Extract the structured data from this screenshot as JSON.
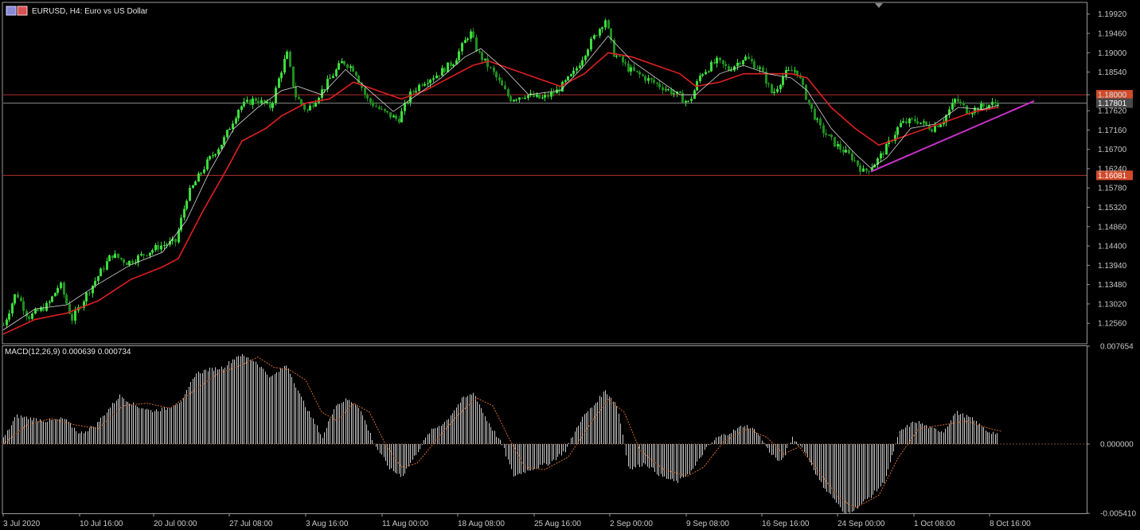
{
  "window": {
    "title": "EURUSD, H4:  Euro vs US Dollar",
    "symbol_icon": "flag-pair-icon"
  },
  "colors": {
    "background": "#000000",
    "bull_candle": "#3ddc3d",
    "bear_candle": "#1f8f1f",
    "ma_slow": "#e02020",
    "ma_fast": "#d8d8d8",
    "level_line": "#b0302a",
    "current_price_line": "#8a8a8a",
    "trendline": "#c832c8",
    "macd_hist": "#c8c8c8",
    "macd_signal": "#d2692a",
    "frame": "#9a9a9a"
  },
  "chart_data": [
    {
      "type": "candlestick",
      "instrument": "EURUSD",
      "timeframe": "H4",
      "title": "EURUSD, H4:  Euro vs US Dollar",
      "ylim": [
        1.1209,
        1.2018
      ],
      "y_ticks": [
        "1.19920",
        "1.19460",
        "1.19000",
        "1.18540",
        "1.18000",
        "1.17620",
        "1.17160",
        "1.16700",
        "1.16240",
        "1.15780",
        "1.15320",
        "1.14860",
        "1.14400",
        "1.13940",
        "1.13480",
        "1.13020",
        "1.12560"
      ],
      "x_ticks": [
        "3 Jul 2020",
        "10 Jul 16:00",
        "20 Jul 00:00",
        "27 Jul 08:00",
        "3 Aug 16:00",
        "11 Aug 00:00",
        "18 Aug 08:00",
        "25 Aug 16:00",
        "2 Sep 00:00",
        "9 Sep 08:00",
        "16 Sep 16:00",
        "24 Sep 00:00",
        "1 Oct 08:00",
        "8 Oct 16:00"
      ],
      "close_path": [
        [
          0,
          1.1232
        ],
        [
          20,
          1.133
        ],
        [
          35,
          1.127
        ],
        [
          60,
          1.13
        ],
        [
          75,
          1.135
        ],
        [
          90,
          1.1265
        ],
        [
          110,
          1.133
        ],
        [
          140,
          1.142
        ],
        [
          160,
          1.14
        ],
        [
          180,
          1.142
        ],
        [
          200,
          1.144
        ],
        [
          220,
          1.145
        ],
        [
          235,
          1.156
        ],
        [
          260,
          1.164
        ],
        [
          280,
          1.169
        ],
        [
          300,
          1.177
        ],
        [
          320,
          1.179
        ],
        [
          340,
          1.177
        ],
        [
          350,
          1.184
        ],
        [
          360,
          1.19
        ],
        [
          370,
          1.18
        ],
        [
          385,
          1.176
        ],
        [
          400,
          1.18
        ],
        [
          415,
          1.184
        ],
        [
          430,
          1.188
        ],
        [
          445,
          1.186
        ],
        [
          460,
          1.179
        ],
        [
          480,
          1.176
        ],
        [
          500,
          1.174
        ],
        [
          515,
          1.18
        ],
        [
          530,
          1.183
        ],
        [
          550,
          1.185
        ],
        [
          570,
          1.188
        ],
        [
          590,
          1.195
        ],
        [
          600,
          1.19
        ],
        [
          620,
          1.185
        ],
        [
          640,
          1.179
        ],
        [
          660,
          1.18
        ],
        [
          680,
          1.179
        ],
        [
          700,
          1.181
        ],
        [
          720,
          1.185
        ],
        [
          740,
          1.192
        ],
        [
          760,
          1.198
        ],
        [
          770,
          1.19
        ],
        [
          790,
          1.186
        ],
        [
          810,
          1.184
        ],
        [
          830,
          1.182
        ],
        [
          850,
          1.18
        ],
        [
          865,
          1.178
        ],
        [
          880,
          1.185
        ],
        [
          900,
          1.188
        ],
        [
          915,
          1.186
        ],
        [
          935,
          1.189
        ],
        [
          955,
          1.186
        ],
        [
          970,
          1.18
        ],
        [
          985,
          1.185
        ],
        [
          1000,
          1.186
        ],
        [
          1015,
          1.178
        ],
        [
          1030,
          1.172
        ],
        [
          1050,
          1.168
        ],
        [
          1070,
          1.165
        ],
        [
          1085,
          1.1615
        ],
        [
          1100,
          1.164
        ],
        [
          1115,
          1.168
        ],
        [
          1130,
          1.173
        ],
        [
          1150,
          1.174
        ],
        [
          1170,
          1.172
        ],
        [
          1185,
          1.174
        ],
        [
          1200,
          1.179
        ],
        [
          1215,
          1.176
        ],
        [
          1230,
          1.177
        ],
        [
          1250,
          1.178
        ]
      ],
      "ma_fast_path": [
        [
          0,
          1.124
        ],
        [
          40,
          1.129
        ],
        [
          80,
          1.13
        ],
        [
          120,
          1.135
        ],
        [
          160,
          1.1395
        ],
        [
          200,
          1.1425
        ],
        [
          230,
          1.15
        ],
        [
          260,
          1.162
        ],
        [
          290,
          1.172
        ],
        [
          320,
          1.177
        ],
        [
          350,
          1.181
        ],
        [
          370,
          1.182
        ],
        [
          400,
          1.18
        ],
        [
          430,
          1.186
        ],
        [
          460,
          1.181
        ],
        [
          490,
          1.176
        ],
        [
          520,
          1.18
        ],
        [
          550,
          1.184
        ],
        [
          580,
          1.189
        ],
        [
          600,
          1.191
        ],
        [
          630,
          1.186
        ],
        [
          660,
          1.18
        ],
        [
          700,
          1.181
        ],
        [
          730,
          1.187
        ],
        [
          760,
          1.194
        ],
        [
          790,
          1.188
        ],
        [
          820,
          1.184
        ],
        [
          850,
          1.18
        ],
        [
          870,
          1.18
        ],
        [
          900,
          1.185
        ],
        [
          930,
          1.187
        ],
        [
          960,
          1.185
        ],
        [
          990,
          1.184
        ],
        [
          1010,
          1.181
        ],
        [
          1040,
          1.172
        ],
        [
          1070,
          1.166
        ],
        [
          1090,
          1.1625
        ],
        [
          1110,
          1.165
        ],
        [
          1140,
          1.172
        ],
        [
          1170,
          1.173
        ],
        [
          1200,
          1.177
        ],
        [
          1230,
          1.1765
        ],
        [
          1250,
          1.1775
        ]
      ],
      "ma_slow_path": [
        [
          0,
          1.123
        ],
        [
          40,
          1.1265
        ],
        [
          80,
          1.128
        ],
        [
          120,
          1.131
        ],
        [
          160,
          1.136
        ],
        [
          200,
          1.139
        ],
        [
          220,
          1.141
        ],
        [
          250,
          1.152
        ],
        [
          280,
          1.162
        ],
        [
          300,
          1.169
        ],
        [
          330,
          1.172
        ],
        [
          350,
          1.175
        ],
        [
          380,
          1.178
        ],
        [
          410,
          1.179
        ],
        [
          440,
          1.183
        ],
        [
          470,
          1.181
        ],
        [
          500,
          1.179
        ],
        [
          530,
          1.181
        ],
        [
          560,
          1.184
        ],
        [
          590,
          1.187
        ],
        [
          610,
          1.188
        ],
        [
          640,
          1.186
        ],
        [
          670,
          1.184
        ],
        [
          700,
          1.182
        ],
        [
          730,
          1.185
        ],
        [
          760,
          1.19
        ],
        [
          790,
          1.189
        ],
        [
          820,
          1.187
        ],
        [
          850,
          1.185
        ],
        [
          870,
          1.182
        ],
        [
          900,
          1.183
        ],
        [
          930,
          1.185
        ],
        [
          960,
          1.185
        ],
        [
          990,
          1.185
        ],
        [
          1010,
          1.184
        ],
        [
          1040,
          1.177
        ],
        [
          1070,
          1.172
        ],
        [
          1100,
          1.168
        ],
        [
          1130,
          1.17
        ],
        [
          1160,
          1.172
        ],
        [
          1190,
          1.174
        ],
        [
          1220,
          1.176
        ],
        [
          1250,
          1.177
        ]
      ],
      "horizontal_levels": [
        {
          "price": 1.18,
          "label": "1.18000",
          "color": "#b0302a"
        },
        {
          "price": 1.16081,
          "label": "1.16081",
          "color": "#b0302a"
        }
      ],
      "current_price": {
        "price": 1.17801,
        "label": "1.17801"
      },
      "trendline": {
        "from": [
          1090,
          1.1617
        ],
        "to": [
          1295,
          1.1785
        ]
      },
      "candle_x_range": [
        4,
        1254
      ]
    },
    {
      "type": "histogram",
      "indicator": "MACD(12,26,9)",
      "title": "MACD(12,26,9) 0.000639 0.000734",
      "ylim": [
        -0.00541,
        0.007654
      ],
      "y_ticks": [
        "0.007654",
        "0.000000",
        "-0.005410"
      ],
      "hist_path": [
        [
          0,
          0.0
        ],
        [
          20,
          0.0022
        ],
        [
          40,
          0.002
        ],
        [
          60,
          0.0018
        ],
        [
          80,
          0.002
        ],
        [
          100,
          0.0008
        ],
        [
          120,
          0.0015
        ],
        [
          150,
          0.0038
        ],
        [
          170,
          0.003
        ],
        [
          190,
          0.0026
        ],
        [
          210,
          0.0028
        ],
        [
          230,
          0.0035
        ],
        [
          245,
          0.0055
        ],
        [
          260,
          0.0058
        ],
        [
          280,
          0.006
        ],
        [
          300,
          0.007
        ],
        [
          320,
          0.0065
        ],
        [
          340,
          0.0052
        ],
        [
          360,
          0.0062
        ],
        [
          375,
          0.004
        ],
        [
          390,
          0.0022
        ],
        [
          405,
          0.0005
        ],
        [
          420,
          0.003
        ],
        [
          435,
          0.0035
        ],
        [
          450,
          0.003
        ],
        [
          470,
          0.0
        ],
        [
          490,
          -0.002
        ],
        [
          505,
          -0.0025
        ],
        [
          520,
          -0.001
        ],
        [
          540,
          0.001
        ],
        [
          560,
          0.0018
        ],
        [
          580,
          0.0035
        ],
        [
          595,
          0.004
        ],
        [
          610,
          0.002
        ],
        [
          630,
          0.0
        ],
        [
          645,
          -0.0025
        ],
        [
          665,
          -0.002
        ],
        [
          690,
          -0.0015
        ],
        [
          710,
          -0.0005
        ],
        [
          730,
          0.002
        ],
        [
          745,
          0.003
        ],
        [
          760,
          0.0042
        ],
        [
          775,
          0.003
        ],
        [
          790,
          -0.002
        ],
        [
          810,
          -0.0015
        ],
        [
          830,
          -0.0025
        ],
        [
          850,
          -0.003
        ],
        [
          870,
          -0.002
        ],
        [
          885,
          -0.0005
        ],
        [
          900,
          0.0005
        ],
        [
          920,
          0.001
        ],
        [
          935,
          0.0015
        ],
        [
          950,
          0.001
        ],
        [
          965,
          -0.0005
        ],
        [
          980,
          -0.0015
        ],
        [
          995,
          0.0005
        ],
        [
          1010,
          -0.0005
        ],
        [
          1030,
          -0.003
        ],
        [
          1050,
          -0.0045
        ],
        [
          1060,
          -0.0055
        ],
        [
          1075,
          -0.005
        ],
        [
          1095,
          -0.004
        ],
        [
          1110,
          -0.003
        ],
        [
          1130,
          0.001
        ],
        [
          1150,
          0.0018
        ],
        [
          1170,
          0.0012
        ],
        [
          1185,
          0.001
        ],
        [
          1200,
          0.0025
        ],
        [
          1220,
          0.002
        ],
        [
          1240,
          0.001
        ],
        [
          1254,
          0.0008
        ]
      ],
      "signal_path": [
        [
          0,
          0.0
        ],
        [
          30,
          0.0015
        ],
        [
          60,
          0.002
        ],
        [
          90,
          0.0015
        ],
        [
          120,
          0.0012
        ],
        [
          150,
          0.003
        ],
        [
          180,
          0.0032
        ],
        [
          210,
          0.0028
        ],
        [
          240,
          0.0042
        ],
        [
          270,
          0.0055
        ],
        [
          300,
          0.0062
        ],
        [
          320,
          0.0068
        ],
        [
          340,
          0.006
        ],
        [
          360,
          0.0058
        ],
        [
          380,
          0.005
        ],
        [
          400,
          0.0025
        ],
        [
          420,
          0.0018
        ],
        [
          440,
          0.0032
        ],
        [
          460,
          0.0025
        ],
        [
          480,
          0.0
        ],
        [
          500,
          -0.0018
        ],
        [
          520,
          -0.0015
        ],
        [
          540,
          0.0
        ],
        [
          570,
          0.0022
        ],
        [
          595,
          0.0036
        ],
        [
          615,
          0.003
        ],
        [
          635,
          0.0005
        ],
        [
          655,
          -0.0018
        ],
        [
          680,
          -0.002
        ],
        [
          710,
          -0.001
        ],
        [
          740,
          0.0018
        ],
        [
          760,
          0.0035
        ],
        [
          780,
          0.0025
        ],
        [
          800,
          -0.0005
        ],
        [
          830,
          -0.002
        ],
        [
          860,
          -0.0025
        ],
        [
          880,
          -0.0018
        ],
        [
          905,
          0.0002
        ],
        [
          935,
          0.0012
        ],
        [
          960,
          0.0005
        ],
        [
          980,
          -0.0008
        ],
        [
          1000,
          -0.0002
        ],
        [
          1020,
          -0.0018
        ],
        [
          1050,
          -0.0042
        ],
        [
          1070,
          -0.005
        ],
        [
          1100,
          -0.004
        ],
        [
          1125,
          -0.001
        ],
        [
          1150,
          0.0012
        ],
        [
          1180,
          0.0015
        ],
        [
          1210,
          0.0018
        ],
        [
          1240,
          0.0012
        ],
        [
          1254,
          0.001
        ]
      ]
    }
  ]
}
